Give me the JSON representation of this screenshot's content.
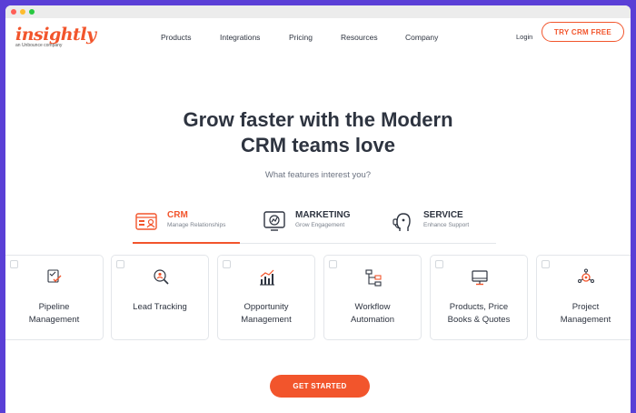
{
  "colors": {
    "brand": "#f2552c",
    "frame": "#5a3fd6",
    "text": "#2e3440"
  },
  "logo": {
    "word": "insightly",
    "tagline": "an Unbounce company"
  },
  "nav": {
    "items": [
      "Products",
      "Integrations",
      "Pricing",
      "Resources",
      "Company"
    ],
    "login": "Login",
    "cta": "TRY CRM FREE"
  },
  "hero": {
    "title_line1": "Grow faster with the Modern",
    "title_line2": "CRM teams love",
    "subtitle": "What features interest you?"
  },
  "tabs": [
    {
      "name": "CRM",
      "desc": "Manage Relationships",
      "icon": "contact-card-icon",
      "active": true
    },
    {
      "name": "MARKETING",
      "desc": "Grow Engagement",
      "icon": "growth-chart-icon",
      "active": false
    },
    {
      "name": "SERVICE",
      "desc": "Enhance Support",
      "icon": "headset-icon",
      "active": false
    }
  ],
  "cards": [
    {
      "line1": "Pipeline",
      "line2": "Management",
      "icon": "checklist-icon"
    },
    {
      "line1": "Lead Tracking",
      "line2": "",
      "icon": "magnifier-person-icon"
    },
    {
      "line1": "Opportunity",
      "line2": "Management",
      "icon": "bar-chart-icon"
    },
    {
      "line1": "Workflow",
      "line2": "Automation",
      "icon": "workflow-icon"
    },
    {
      "line1": "Products, Price",
      "line2": "Books & Quotes",
      "icon": "monitor-icon"
    },
    {
      "line1": "Project",
      "line2": "Management",
      "icon": "gear-network-icon"
    }
  ],
  "cta": "GET STARTED"
}
